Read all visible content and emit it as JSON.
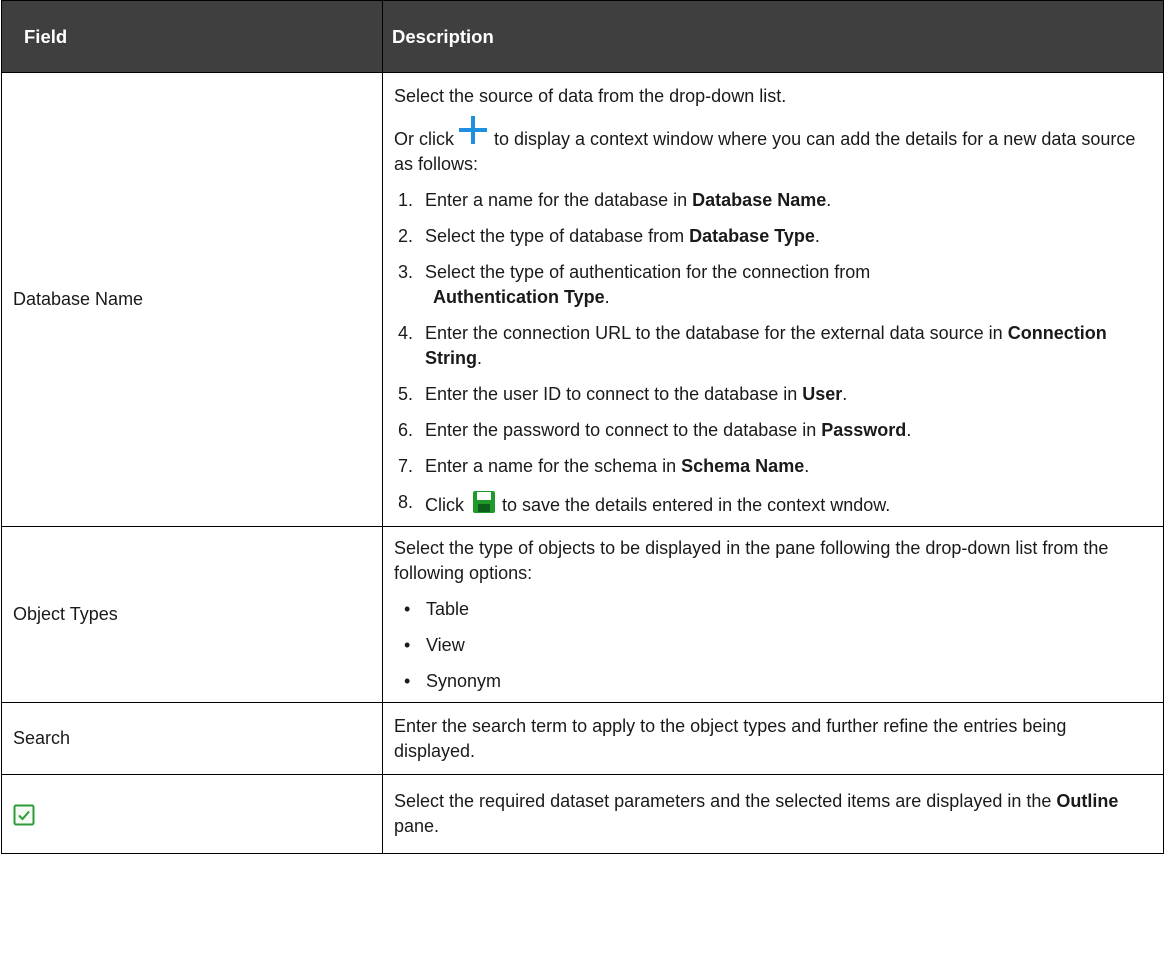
{
  "header": {
    "field": "Field",
    "description": "Description"
  },
  "rows": {
    "database_name": {
      "field": "Database Name",
      "p1": "Select the source of data from the drop-down list.",
      "p2_before": "Or click",
      "p2_after": "to display a context window where you can add the details for a new data source as follows:",
      "steps": [
        {
          "num": "1.",
          "pre": "Enter a name for the database in ",
          "bold": "Database Name",
          "post": "."
        },
        {
          "num": "2.",
          "pre": "Select the type of database from ",
          "bold": "Database Type",
          "post": "."
        },
        {
          "num": "3.",
          "pre": "Select the type of authentication for the connection from ",
          "bold": "Authentication Type",
          "post": "."
        },
        {
          "num": "4.",
          "pre": "Enter the connection URL to the database for the external data source in ",
          "bold": "Connection String",
          "post": "."
        },
        {
          "num": "5.",
          "pre": "Enter the user ID to connect to the database in ",
          "bold": "User",
          "post": "."
        },
        {
          "num": "6.",
          "pre": "Enter the password to connect to the database in ",
          "bold": "Password",
          "post": "."
        },
        {
          "num": "7.",
          "pre": "Enter a name for the schema in ",
          "bold": "Schema Name",
          "post": "."
        },
        {
          "num": "8.",
          "pre": "Click",
          "post": "to save the details entered in the context wndow."
        }
      ]
    },
    "object_types": {
      "field": "Object Types",
      "intro": "Select the type of objects to be displayed in the pane following the drop-down list from the following options:",
      "options": [
        "Table",
        "View",
        "Synonym"
      ]
    },
    "search": {
      "field": "Search",
      "desc": "Enter the search term to apply to the object types and further refine the entries being displayed."
    },
    "select": {
      "desc_pre": "Select the required dataset parameters and the selected items are displayed in the ",
      "desc_bold": "Outline",
      "desc_post": " pane."
    }
  },
  "icons": {
    "add": "plus-icon",
    "save": "save-icon",
    "select": "checkbox-icon"
  },
  "colors": {
    "header_bg": "#3f3f3f",
    "plus": "#1f8fe0",
    "save_green": "#1f9a2a",
    "check_green": "#2e9a3a"
  }
}
